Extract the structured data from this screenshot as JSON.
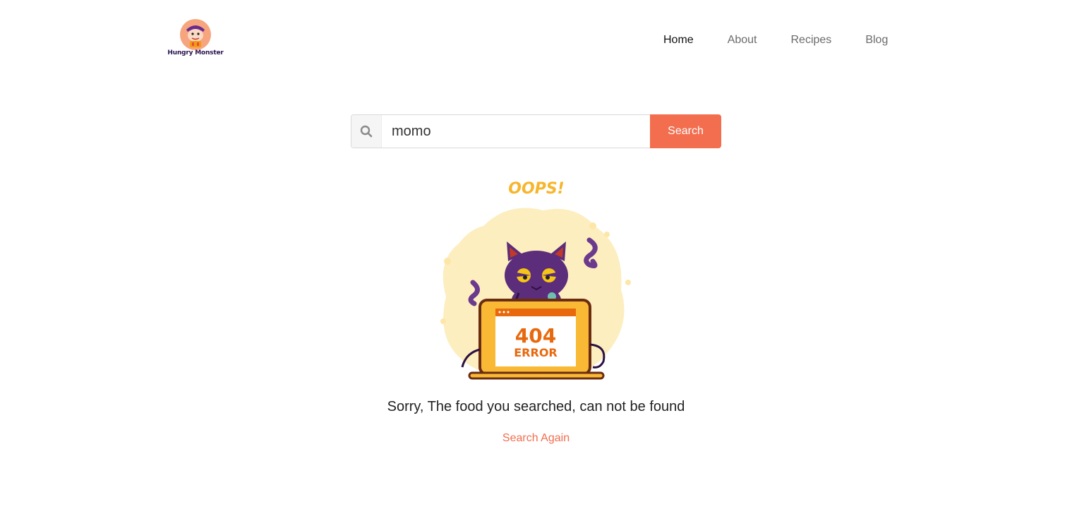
{
  "brand": {
    "name": "Hungry Monster"
  },
  "nav": {
    "items": [
      {
        "label": "Home",
        "active": true
      },
      {
        "label": "About",
        "active": false
      },
      {
        "label": "Recipes",
        "active": false
      },
      {
        "label": "Blog",
        "active": false
      }
    ]
  },
  "search": {
    "icon": "search-icon",
    "value": "momo",
    "button_label": "Search"
  },
  "error": {
    "oops_text": "OOPS!",
    "code_text": "404",
    "error_word": "ERROR",
    "message": "Sorry, The food you searched, can not be found",
    "search_again": "Search Again"
  },
  "colors": {
    "accent": "#f26e4f",
    "oops": "#f7b52b",
    "error_text": "#e8690d",
    "cat": "#5b2d7a",
    "blob": "#fdeec0"
  }
}
